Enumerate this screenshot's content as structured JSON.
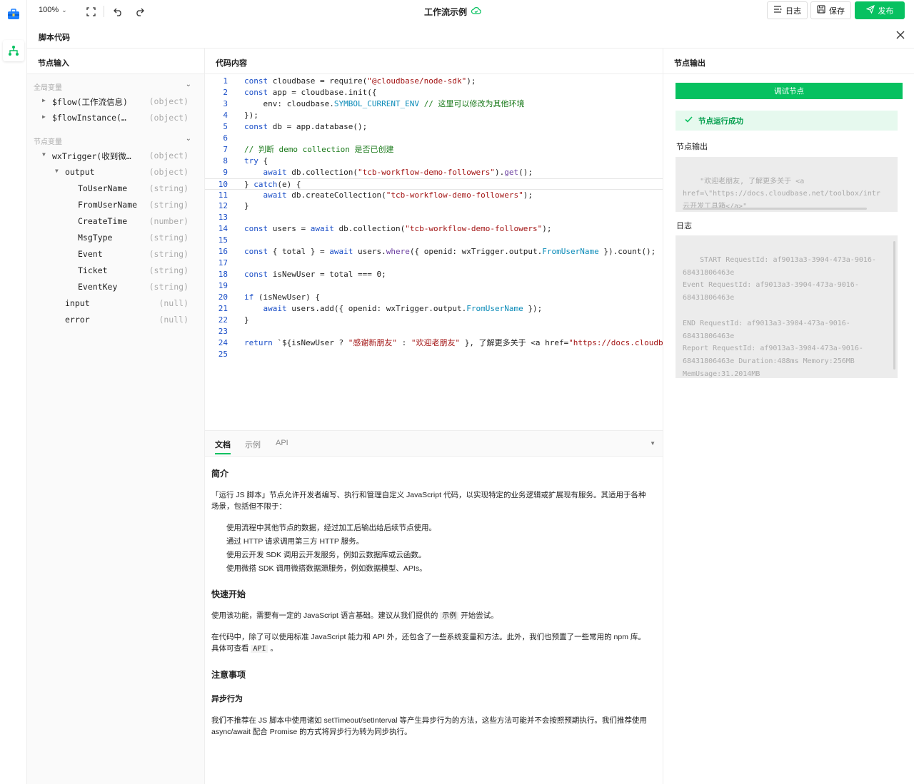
{
  "topbar": {
    "zoom": "100%",
    "title": "工作流示例",
    "log_label": "日志",
    "save_label": "保存",
    "publish_label": "发布"
  },
  "subhead": {
    "title": "脚本代码"
  },
  "left": {
    "header": "节点输入",
    "groups": [
      {
        "label": "全局变量"
      },
      {
        "label": "节点变量"
      }
    ],
    "rows": [
      {
        "name": "$flow(工作流信息)",
        "type": "(object)"
      },
      {
        "name": "$flowInstance(…",
        "type": "(object)"
      },
      {
        "name": "wxTrigger(收到微…",
        "type": "(object)"
      },
      {
        "name": "output",
        "type": "(object)"
      },
      {
        "name": "ToUserName",
        "type": "(string)"
      },
      {
        "name": "FromUserName",
        "type": "(string)"
      },
      {
        "name": "CreateTime",
        "type": "(number)"
      },
      {
        "name": "MsgType",
        "type": "(string)"
      },
      {
        "name": "Event",
        "type": "(string)"
      },
      {
        "name": "Ticket",
        "type": "(string)"
      },
      {
        "name": "EventKey",
        "type": "(string)"
      },
      {
        "name": "input",
        "type": "(null)"
      },
      {
        "name": "error",
        "type": "(null)"
      }
    ]
  },
  "middle": {
    "header": "代码内容",
    "code_lines": [
      "const cloudbase = require(\"@cloudbase/node-sdk\");",
      "const app = cloudbase.init({",
      "    env: cloudbase.SYMBOL_CURRENT_ENV // 这里可以修改为其他环境",
      "});",
      "const db = app.database();",
      "",
      "// 判断 demo collection 是否已创建",
      "try {",
      "    await db.collection(\"tcb-workflow-demo-followers\").get();",
      "} catch(e) {",
      "    await db.createCollection(\"tcb-workflow-demo-followers\");",
      "}",
      "",
      "const users = await db.collection(\"tcb-workflow-demo-followers\");",
      "",
      "const { total } = await users.where({ openid: wxTrigger.output.FromUserName }).count();",
      "",
      "const isNewUser = total === 0;",
      "",
      "if (isNewUser) {",
      "    await users.add({ openid: wxTrigger.output.FromUserName });",
      "}",
      "",
      "return `${isNewUser ? \"感谢新朋友\" : \"欢迎老朋友\" }, 了解更多关于 <a href=\"https://docs.cloudbase.",
      ""
    ],
    "tabs": [
      "文档",
      "示例",
      "API"
    ],
    "docs": {
      "h_intro": "简介",
      "intro": "「运行 JS 脚本」节点允许开发者编写、执行和管理自定义 JavaScript 代码，以实现特定的业务逻辑或扩展现有服务。其适用于各种场景，包括但不限于：",
      "bullets": [
        "使用流程中其他节点的数据，经过加工后输出给后续节点使用。",
        "通过 HTTP 请求调用第三方 HTTP 服务。",
        "使用云开发 SDK 调用云开发服务，例如云数据库或云函数。",
        "使用微搭 SDK 调用微搭数据源服务，例如数据模型、APIs。"
      ],
      "h_quick": "快速开始",
      "quick_1a": "使用该功能，需要有一定的 JavaScript 语言基础。建议从我们提供的",
      "quick_1_code": "示例",
      "quick_1b": "开始尝试。",
      "quick_2a": "在代码中，除了可以使用标准 JavaScript 能力和 API 外，还包含了一些系统变量和方法。此外，我们也预置了一些常用的 npm 库。具体可查看",
      "quick_2_code": "API",
      "quick_2b": "。",
      "h_notes": "注意事项",
      "h_async": "异步行为",
      "async": "我们不推荐在 JS 脚本中使用诸如 setTimeout/setInterval 等产生异步行为的方法，这些方法可能并不会按照预期执行。我们推荐使用 async/await 配合 Promise 的方式将异步行为转为同步执行。"
    }
  },
  "right": {
    "header": "节点输出",
    "run_label": "调试节点",
    "success_label": "节点运行成功",
    "output_label": "节点输出",
    "output_text": "\"欢迎老朋友, 了解更多关于 <a\nhref=\\\"https://docs.cloudbase.net/toolbox/intr\n云开发工具箱</a>\"",
    "log_label": "日志",
    "log_text": "START RequestId: af9013a3-3904-473a-9016-\n68431806463e\nEvent RequestId: af9013a3-3904-473a-9016-\n68431806463e\n\nEND RequestId: af9013a3-3904-473a-9016-\n68431806463e\nReport RequestId: af9013a3-3904-473a-9016-\n68431806463e Duration:488ms Memory:256MB\nMemUsage:31.2014MB"
  },
  "colors": {
    "accent": "#07c160",
    "success_bg": "#e6f9ee"
  }
}
